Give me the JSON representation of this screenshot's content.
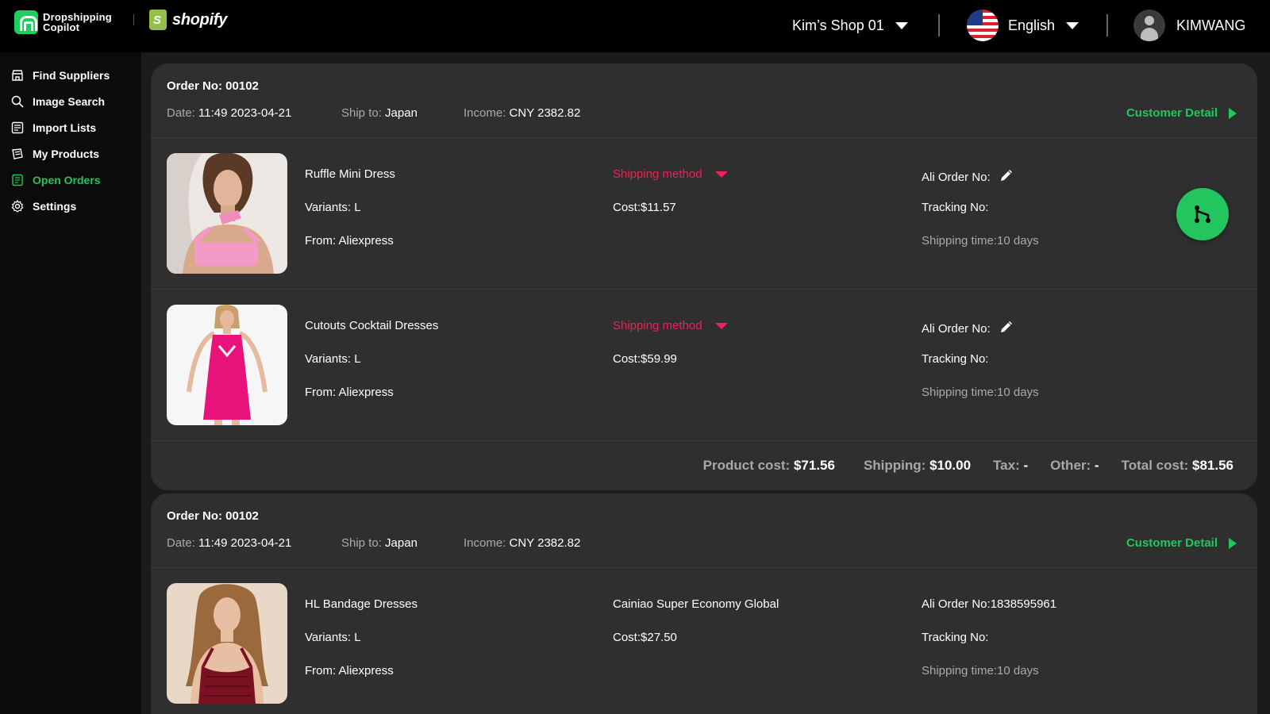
{
  "header": {
    "brand_name": "Dropshipping Copilot",
    "shopify_label": "shopify",
    "shop": "Kim’s Shop 01",
    "language": "English",
    "user": "KIMWANG"
  },
  "sidebar": {
    "items": [
      {
        "label": "Find Suppliers",
        "icon": "store-icon"
      },
      {
        "label": "Image Search",
        "icon": "search-icon"
      },
      {
        "label": "Import Lists",
        "icon": "list-icon"
      },
      {
        "label": "My Products",
        "icon": "products-icon"
      },
      {
        "label": "Open Orders",
        "icon": "orders-icon",
        "active": true
      },
      {
        "label": "Settings",
        "icon": "gear-icon"
      }
    ]
  },
  "labels": {
    "date": "Date:",
    "ship_to": "Ship to:",
    "income": "Income:",
    "customer_detail": "Customer Detail",
    "product_cost": "Product cost:",
    "shipping": "Shipping:",
    "tax": "Tax:",
    "other": "Other:",
    "total_cost": "Total cost:"
  },
  "orders": [
    {
      "order_no": "Order No: 00102",
      "date": "11:49 2023-04-21",
      "ship_to": "Japan",
      "income": "CNY 2382.82",
      "items": [
        {
          "name": "Ruffle Mini Dress",
          "variants": "Variants: L",
          "from": "From: Aliexpress",
          "shipping_method": "Shipping method",
          "cost": "Cost:$11.57",
          "ali_order": "Ali Order No:",
          "tracking": "Tracking No:",
          "shipping_time": "Shipping time:10 days"
        },
        {
          "name": "Cutouts Cocktail Dresses",
          "variants": "Variants: L",
          "from": "From: Aliexpress",
          "shipping_method": "Shipping method",
          "cost": "Cost:$59.99",
          "ali_order": "Ali Order No:",
          "tracking": "Tracking No:",
          "shipping_time": "Shipping time:10 days"
        }
      ],
      "totals": {
        "product_cost": "$71.56",
        "shipping": "$10.00",
        "tax": "-",
        "other": "-",
        "total_cost": "$81.56"
      }
    },
    {
      "order_no": "Order No: 00102",
      "date": "11:49 2023-04-21",
      "ship_to": "Japan",
      "income": "CNY 2382.82",
      "items": [
        {
          "name": "HL Bandage Dresses",
          "variants": "Variants: L",
          "from": "From: Aliexpress",
          "shipping_method": "Cainiao Super Economy Global",
          "cost": "Cost:$27.50",
          "ali_order": "Ali Order No:1838595961",
          "tracking": "Tracking No:",
          "shipping_time": "Shipping time:10 days"
        }
      ]
    }
  ],
  "colors": {
    "accent_green": "#22c55e",
    "shipping_red": "#f0205a",
    "card_bg": "#2f2f2f"
  }
}
